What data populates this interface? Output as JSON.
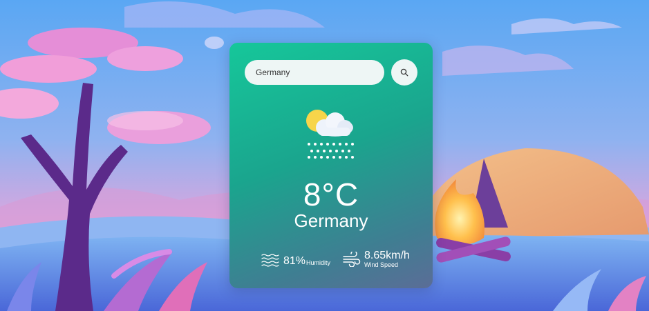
{
  "search": {
    "value": "Germany",
    "placeholder": "",
    "icon": "search-icon"
  },
  "weather": {
    "icon": "cloud-snow-sun-icon",
    "temperature": "8°C",
    "city": "Germany"
  },
  "details": {
    "humidity": {
      "icon": "waves-icon",
      "value": "81%",
      "label": "Humidity"
    },
    "wind": {
      "icon": "wind-icon",
      "value": "8.65km/h",
      "label": "Wind Speed"
    }
  },
  "colors": {
    "card_gradient_start": "#16c79a",
    "card_gradient_end": "#5b6d97",
    "text": "#ffffff",
    "sun": "#f7d54a"
  }
}
